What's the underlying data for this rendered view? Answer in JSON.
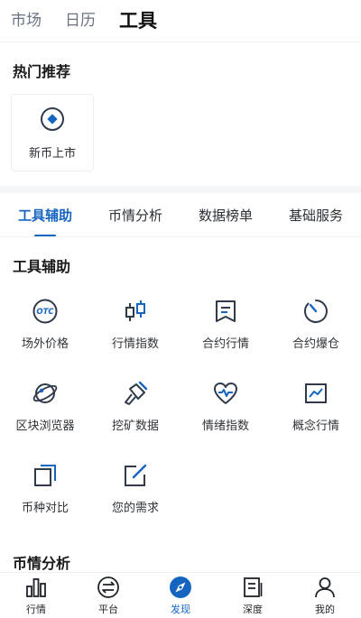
{
  "top_tabs": [
    "市场",
    "日历",
    "工具"
  ],
  "active_top_tab": "工具",
  "hot": {
    "title": "热门推荐",
    "items": [
      {
        "label": "新币上市",
        "icon": "target-icon"
      }
    ]
  },
  "category_tabs": [
    "工具辅助",
    "币情分析",
    "数据榜单",
    "基础服务"
  ],
  "active_category_tab": "工具辅助",
  "section_tools": {
    "title": "工具辅助",
    "items": [
      {
        "label": "场外价格",
        "icon": "otc-icon",
        "icon_text": "OTC"
      },
      {
        "label": "行情指数",
        "icon": "candlestick-icon"
      },
      {
        "label": "合约行情",
        "icon": "bookmark-icon"
      },
      {
        "label": "合约爆仓",
        "icon": "timer-icon"
      },
      {
        "label": "区块浏览器",
        "icon": "planet-icon"
      },
      {
        "label": "挖矿数据",
        "icon": "pickaxe-icon"
      },
      {
        "label": "情绪指数",
        "icon": "heartbeat-icon"
      },
      {
        "label": "概念行情",
        "icon": "trend-chart-icon"
      },
      {
        "label": "币种对比",
        "icon": "compare-icon"
      },
      {
        "label": "您的需求",
        "icon": "edit-icon"
      }
    ]
  },
  "section_analysis": {
    "title": "币情分析"
  },
  "bottom_nav": [
    {
      "label": "行情",
      "icon": "bar-chart-icon"
    },
    {
      "label": "平台",
      "icon": "exchange-icon"
    },
    {
      "label": "发现",
      "icon": "compass-icon",
      "active": true
    },
    {
      "label": "深度",
      "icon": "document-icon"
    },
    {
      "label": "我的",
      "icon": "user-icon"
    }
  ],
  "colors": {
    "accent": "#1565c0",
    "icon": "#2f3a4a",
    "text": "#1f2329"
  }
}
